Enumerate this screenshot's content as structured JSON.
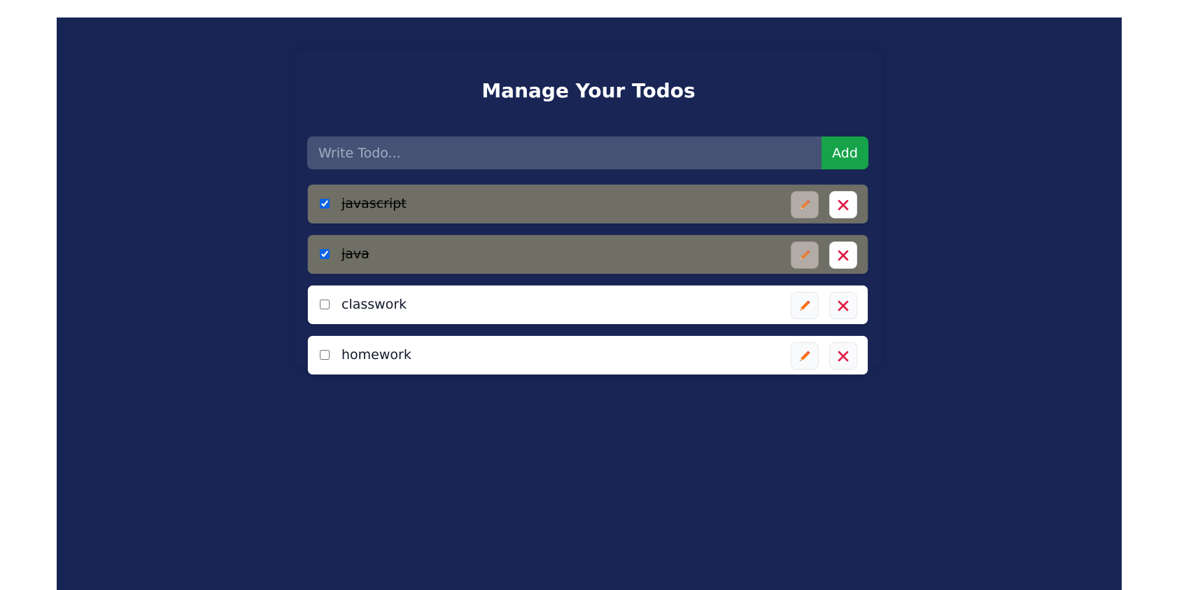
{
  "page": {
    "title": "Manage Your Todos"
  },
  "form": {
    "placeholder": "Write Todo...",
    "value": "",
    "add_label": "Add"
  },
  "todos": [
    {
      "text": "javascript",
      "completed": true
    },
    {
      "text": "java",
      "completed": true
    },
    {
      "text": "classwork",
      "completed": false
    },
    {
      "text": "homework",
      "completed": false
    }
  ],
  "icons": {
    "edit": "pencil-icon",
    "delete": "close-icon"
  },
  "colors": {
    "background": "#172554",
    "input_background": "#465275",
    "accent_green": "#16a34a",
    "completed_row": "#6f6f65",
    "delete_red": "#e11d48",
    "pencil_orange": "#f97316"
  }
}
